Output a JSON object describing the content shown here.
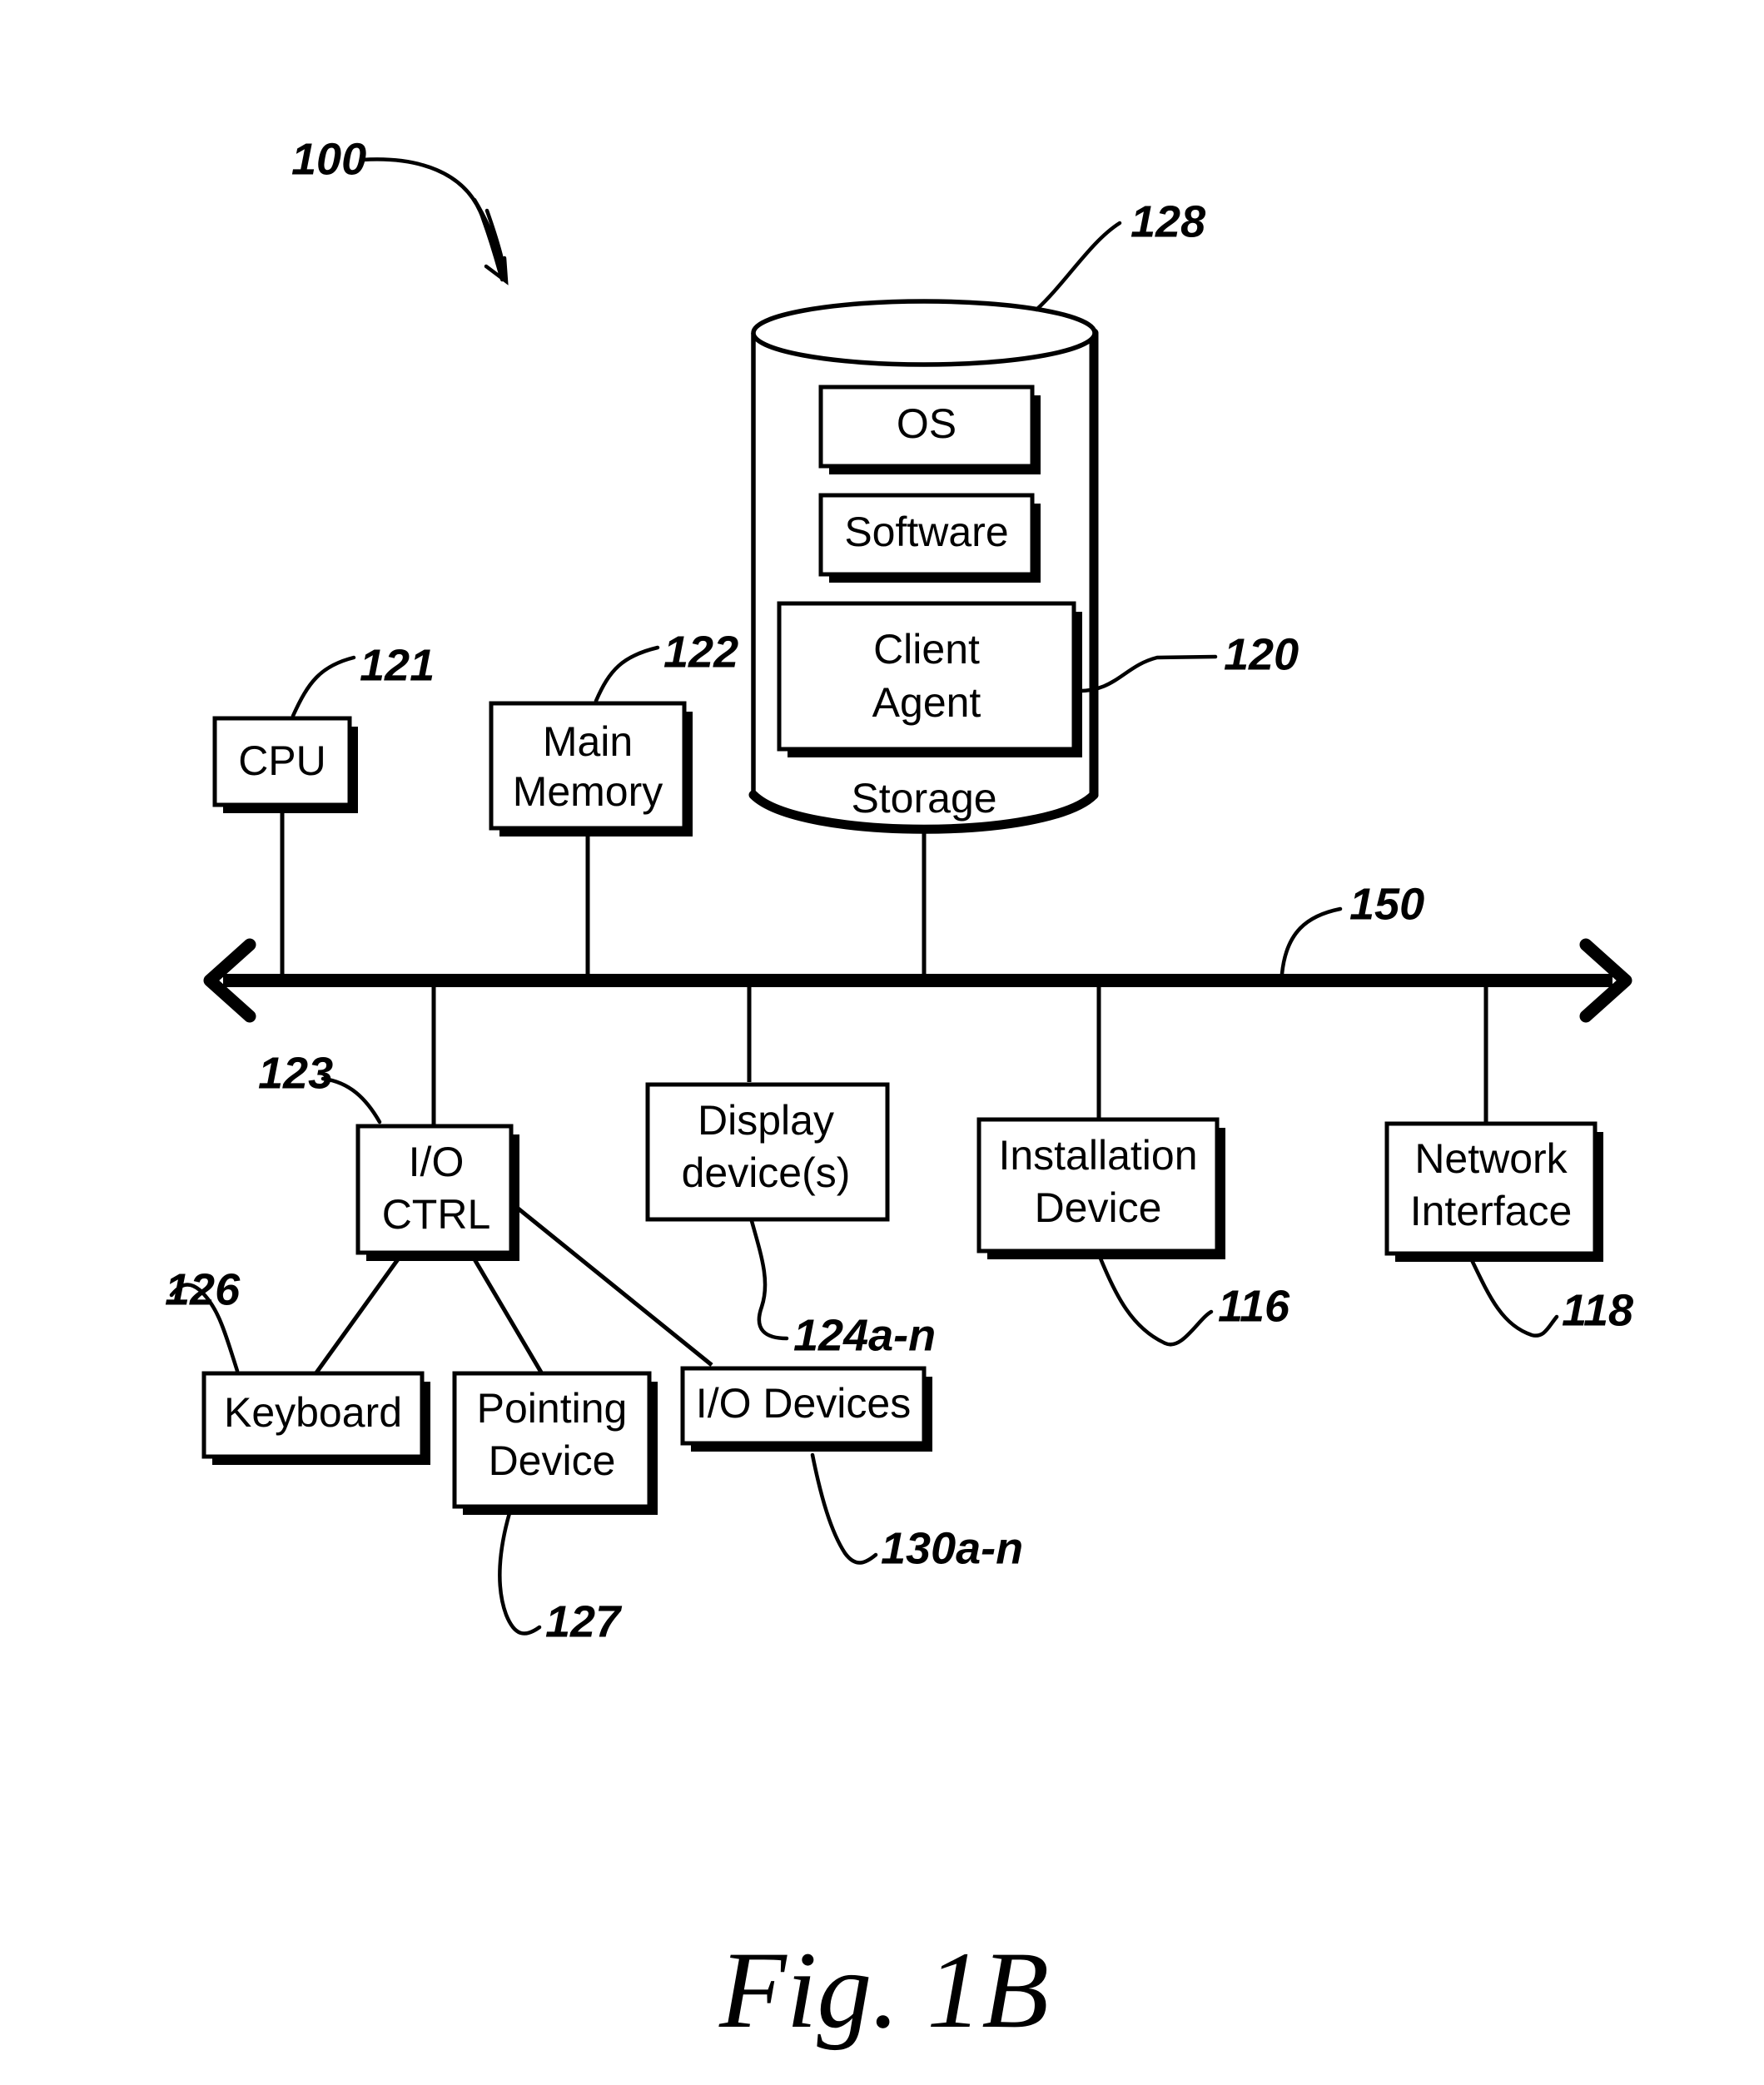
{
  "figure": {
    "caption": "Fig. 1B",
    "overall_ref": "100"
  },
  "storage": {
    "cylinder_label": "Storage",
    "cylinder_ref": "128",
    "inner_boxes": [
      {
        "label": "OS",
        "ref": ""
      },
      {
        "label": "Software",
        "ref": ""
      },
      {
        "label": "Client\nAgent",
        "line1": "Client",
        "line2": "Agent",
        "ref": "120"
      }
    ]
  },
  "components": {
    "cpu": {
      "label": "CPU",
      "ref": "121"
    },
    "main_memory": {
      "line1": "Main",
      "line2": "Memory",
      "ref": "122"
    },
    "io_ctrl": {
      "line1": "I/O",
      "line2": "CTRL",
      "ref": "123"
    },
    "display_devices": {
      "line1": "Display",
      "line2": "device(s)",
      "ref": "124a-n"
    },
    "installation_device": {
      "line1": "Installation",
      "line2": "Device",
      "ref": "116"
    },
    "network_interface": {
      "line1": "Network",
      "line2": "Interface",
      "ref": "118"
    },
    "keyboard": {
      "label": "Keyboard",
      "ref": "126"
    },
    "pointing_device": {
      "line1": "Pointing",
      "line2": "Device",
      "ref": "127"
    },
    "io_devices": {
      "label": "I/O Devices",
      "ref": "130a-n"
    }
  },
  "bus": {
    "ref": "150"
  },
  "colors": {
    "ink": "#000000",
    "paper": "#ffffff"
  }
}
